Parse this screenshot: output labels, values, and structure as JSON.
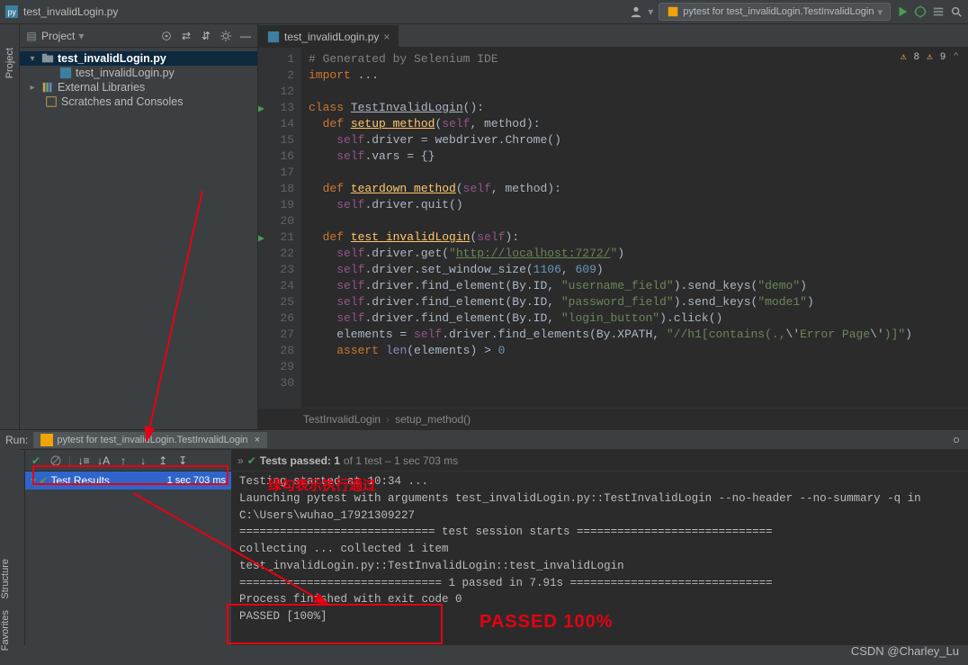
{
  "toolbar": {
    "breadcrumb": "test_invalidLogin.py",
    "run_config": "pytest for test_invalidLogin.TestInvalidLogin"
  },
  "project": {
    "title": "Project",
    "tree": {
      "root": "test_invalidLogin.py",
      "file": "test_invalidLogin.py",
      "ext_libs": "External Libraries",
      "scratches": "Scratches and Consoles"
    }
  },
  "tabs": {
    "file": "test_invalidLogin.py"
  },
  "warnings": {
    "a": "8",
    "b": "9"
  },
  "code": [
    {
      "n": 1,
      "html": "<span class='cmt'># Generated by Selenium IDE</span>"
    },
    {
      "n": 2,
      "html": "<span class='kw'>import</span> ..."
    },
    {
      "n": 12,
      "html": ""
    },
    {
      "n": 13,
      "html": "<span class='kw'>class</span> <span class='cls-u'>TestInvalidLogin</span>():",
      "run": true
    },
    {
      "n": 14,
      "html": "  <span class='dec'>def</span> <span class='fn-u'>setup_method</span>(<span class='self'>self</span>, method):"
    },
    {
      "n": 15,
      "html": "    <span class='self'>self</span>.driver = webdriver.Chrome()"
    },
    {
      "n": 16,
      "html": "    <span class='self'>self</span>.vars = {}"
    },
    {
      "n": 17,
      "html": ""
    },
    {
      "n": 18,
      "html": "  <span class='dec'>def</span> <span class='fn-u'>teardown_method</span>(<span class='self'>self</span>, method):"
    },
    {
      "n": 19,
      "html": "    <span class='self'>self</span>.driver.quit()"
    },
    {
      "n": 20,
      "html": ""
    },
    {
      "n": 21,
      "html": "  <span class='dec'>def</span> <span class='fn-u'>test_invalidLogin</span>(<span class='self'>self</span>):",
      "run": true
    },
    {
      "n": 22,
      "html": "    <span class='self'>self</span>.driver.get(<span class='str'>\"</span><span class='str-u'>http://localhost:7272/</span><span class='str'>\"</span>)"
    },
    {
      "n": 23,
      "html": "    <span class='self'>self</span>.driver.set_window_size(<span class='num'>1106</span>, <span class='num'>609</span>)"
    },
    {
      "n": 24,
      "html": "    <span class='self'>self</span>.driver.find_element(By.ID, <span class='str'>\"username_field\"</span>).send_keys(<span class='str'>\"demo\"</span>)"
    },
    {
      "n": 25,
      "html": "    <span class='self'>self</span>.driver.find_element(By.ID, <span class='str'>\"password_field\"</span>).send_keys(<span class='str'>\"mode1\"</span>)"
    },
    {
      "n": 26,
      "html": "    <span class='self'>self</span>.driver.find_element(By.ID, <span class='str'>\"login_button\"</span>).click()"
    },
    {
      "n": 27,
      "html": "    elements = <span class='self'>self</span>.driver.find_elements(By.XPATH, <span class='str'>\"//h1[contains(.,</span><span class='op'>\\'</span><span class='str'>Error Page</span><span class='op'>\\'</span><span class='str'>)]\"</span>)"
    },
    {
      "n": 28,
      "html": "    <span class='kw'>assert</span> <span class='bi'>len</span>(elements) &gt; <span class='num'>0</span>"
    },
    {
      "n": 29,
      "html": ""
    },
    {
      "n": 30,
      "html": ""
    }
  ],
  "breadcrumbs": {
    "a": "TestInvalidLogin",
    "b": "setup_method()"
  },
  "run": {
    "label": "Run:",
    "tab": "pytest for test_invalidLogin.TestInvalidLogin",
    "status_line": "Tests passed: 1",
    "status_suffix": " of 1 test – 1 sec 703 ms",
    "tree_root": "Test Results",
    "tree_time": "1 sec 703 ms",
    "console": [
      "Testing started at 10:34 ...",
      "Launching pytest with arguments test_invalidLogin.py::TestInvalidLogin --no-header --no-summary -q in C:\\Users\\wuhao_17921309227",
      "",
      "============================= test session starts =============================",
      "collecting ... collected 1 item",
      "",
      "test_invalidLogin.py::TestInvalidLogin::test_invalidLogin ",
      "",
      "============================== 1 passed in 7.91s ==============================",
      "",
      "Process finished with exit code 0",
      "PASSED          [100%]"
    ]
  },
  "annotations": {
    "text1": "绿勾表示执行通过",
    "text2": "PASSED  100%"
  },
  "footer": {
    "watermark": "CSDN @Charley_Lu"
  },
  "sidebar": {
    "structure": "Structure",
    "favorites": "Favorites",
    "project": "Project"
  }
}
